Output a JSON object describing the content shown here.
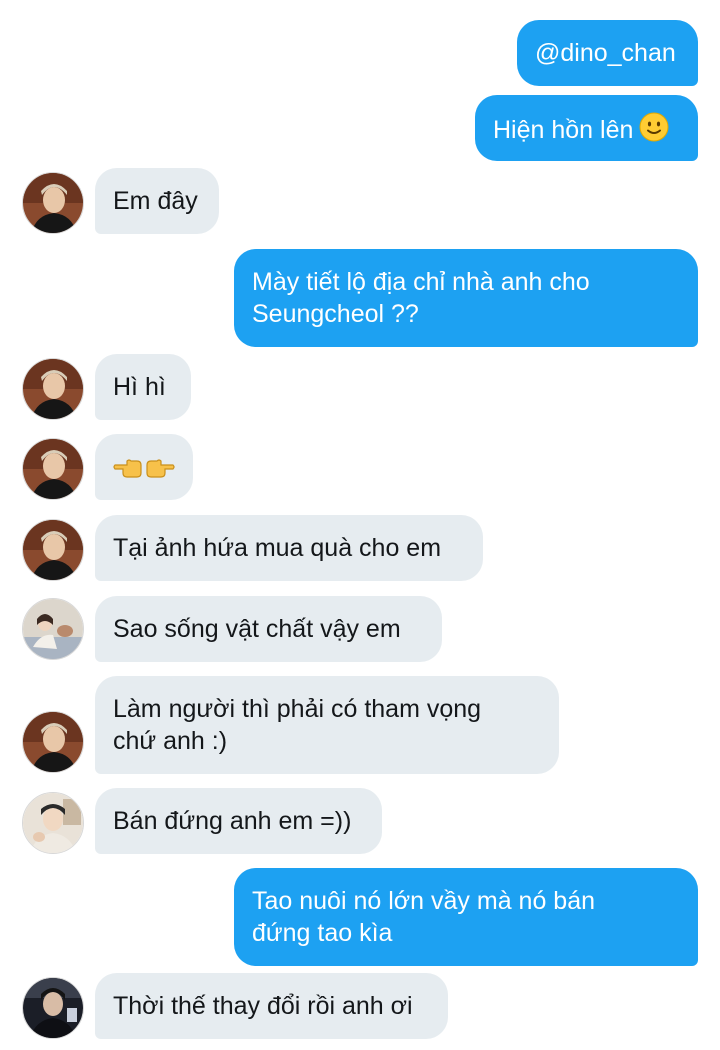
{
  "conversation": {
    "messages": [
      {
        "side": "out",
        "text": "@dino_chan"
      },
      {
        "side": "out",
        "text": "Hiện hồn lên",
        "emoji": "slightly-smiling-face-icon"
      },
      {
        "side": "in",
        "avatar": "avatar-a",
        "text": "Em đây"
      },
      {
        "side": "out",
        "line1": "Mày tiết lộ địa chỉ nhà anh cho",
        "line2": "Seungcheol ??"
      },
      {
        "side": "in",
        "avatar": "avatar-a",
        "text": "Hì hì"
      },
      {
        "side": "in",
        "avatar": "avatar-a",
        "emoji": "pointing-hands-icon"
      },
      {
        "side": "in",
        "avatar": "avatar-a",
        "text": "Tại ảnh hứa mua quà cho em"
      },
      {
        "side": "in",
        "avatar": "avatar-b",
        "text": "Sao sống vật chất vậy em"
      },
      {
        "side": "in",
        "avatar": "avatar-a",
        "line1": "Làm người thì phải có tham vọng",
        "line2": "chứ anh :)"
      },
      {
        "side": "in",
        "avatar": "avatar-c",
        "text": "Bán đứng anh em =))"
      },
      {
        "side": "out",
        "line1": "Tao nuôi nó lớn vầy mà nó bán",
        "line2": "đứng tao kìa"
      },
      {
        "side": "in",
        "avatar": "avatar-d",
        "text": "Thời thế thay đổi rồi anh ơi"
      }
    ]
  },
  "colors": {
    "outgoing_bubble": "#1da1f2",
    "incoming_bubble": "#e6ecf0",
    "incoming_text": "#14171a",
    "outgoing_text": "#ffffff"
  }
}
